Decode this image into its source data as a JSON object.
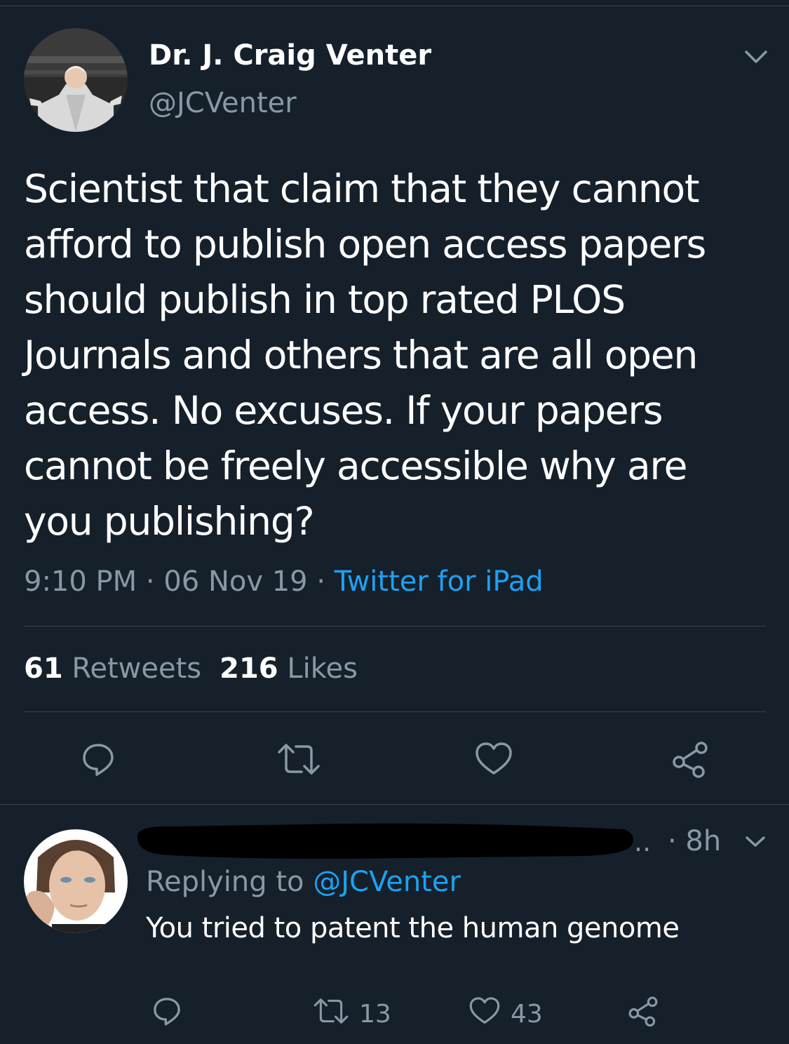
{
  "colors": {
    "background": "#15202b",
    "text_primary": "#ffffff",
    "text_secondary": "#8899a6",
    "link": "#1da1f2",
    "divider": "#38444d"
  },
  "tweet": {
    "author_name": "Dr. J. Craig Venter",
    "author_handle": "@JCVenter",
    "text": "Scientist that claim that they cannot\nafford to publish open access papers\nshould publish in top rated PLOS\nJournals and others that are all open\naccess.  No excuses. If your papers\ncannot be freely accessible why are\nyou publishing?",
    "time": "9:10 PM",
    "separator": " · ",
    "date": "06 Nov 19",
    "source": "Twitter for iPad",
    "retweets_count": "61",
    "retweets_label": "Retweets",
    "likes_count": "216",
    "likes_label": "Likes",
    "actions": [
      "reply-icon",
      "retweet-icon",
      "heart-icon",
      "share-icon"
    ]
  },
  "reply": {
    "author_redacted": true,
    "truncation": "..",
    "time": "· 8h",
    "replying_to_label": "Replying to",
    "replying_to_handle": "@JCVenter",
    "text": "You tried to patent the human genome",
    "retweets_count": "13",
    "likes_count": "43",
    "actions": [
      "reply-icon",
      "retweet-icon",
      "heart-icon",
      "share-icon"
    ]
  }
}
